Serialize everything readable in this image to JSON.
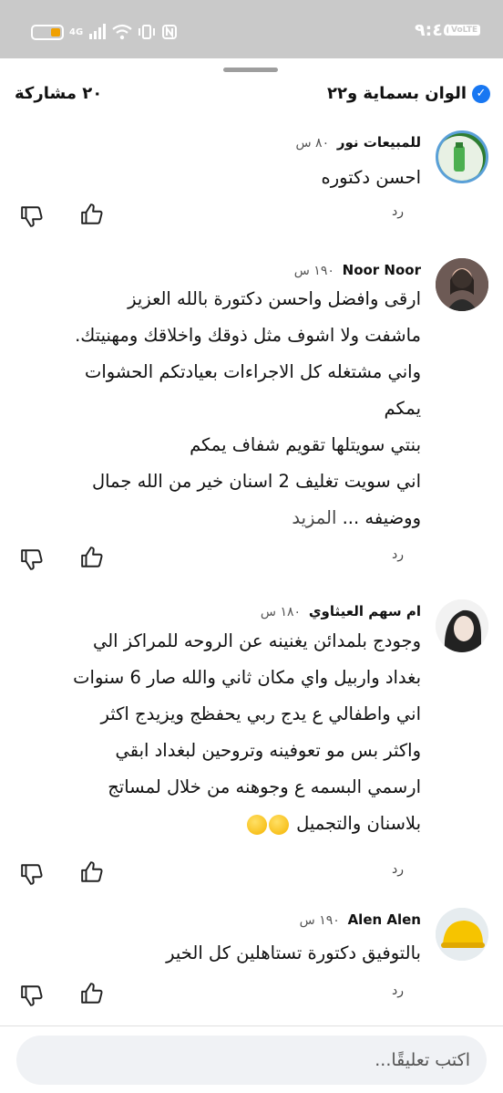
{
  "status_bar": {
    "time": "٩:٤٥",
    "network_badge": "VoLTE",
    "signal_text": "4G"
  },
  "post": {
    "page_name": "الوان بسماية و٢٢",
    "share_count": "٢٠ مشاركة"
  },
  "comments": [
    {
      "name": "للمبيعات نور",
      "time": "٨٠ س",
      "lines": [
        "احسن دكتوره"
      ],
      "reply": "رد"
    },
    {
      "name": "Noor Noor",
      "time": "١٩٠ س",
      "lines": [
        "ارقى وافضل واحسن دكتورة بالله العزيز",
        "ماشفت ولا اشوف مثل ذوقك واخلاقك ومهنيتك.",
        "واني مشتغله كل الاجراءات بعيادتكم الحشوات",
        "يمكم",
        "بنتي سويتلها تقويم شفاف يمكم",
        "اني سويت تغليف 2 اسنان خير من الله جمال",
        "ووضيفه ..."
      ],
      "more": "المزيد",
      "reply": "رد"
    },
    {
      "name": "ام سهم العيثاوي",
      "time": "١٨٠ س",
      "lines": [
        "وجودج بلمدائن يغنينه عن الروحه للمراكز الي",
        "بغداد واربيل واي مكان ثاني والله صار 6 سنوات",
        "اني واطفالي ع يدج ربي يحفظج ويزيدج اكثر",
        "واكثر بس مو تعوفينه وتروحين لبغداد ابقي",
        "ارسمي البسمه ع وجوهنه من خلال لمساتج",
        "بلاسنان والتجميل"
      ],
      "reply": "رد"
    },
    {
      "name": "Alen Alen",
      "time": "١٩٠ س",
      "lines": [
        "بالتوفيق دكتورة تستاهلين كل الخير"
      ],
      "reply": "رد"
    }
  ],
  "composer": {
    "placeholder": "اكتب تعليقًا..."
  }
}
